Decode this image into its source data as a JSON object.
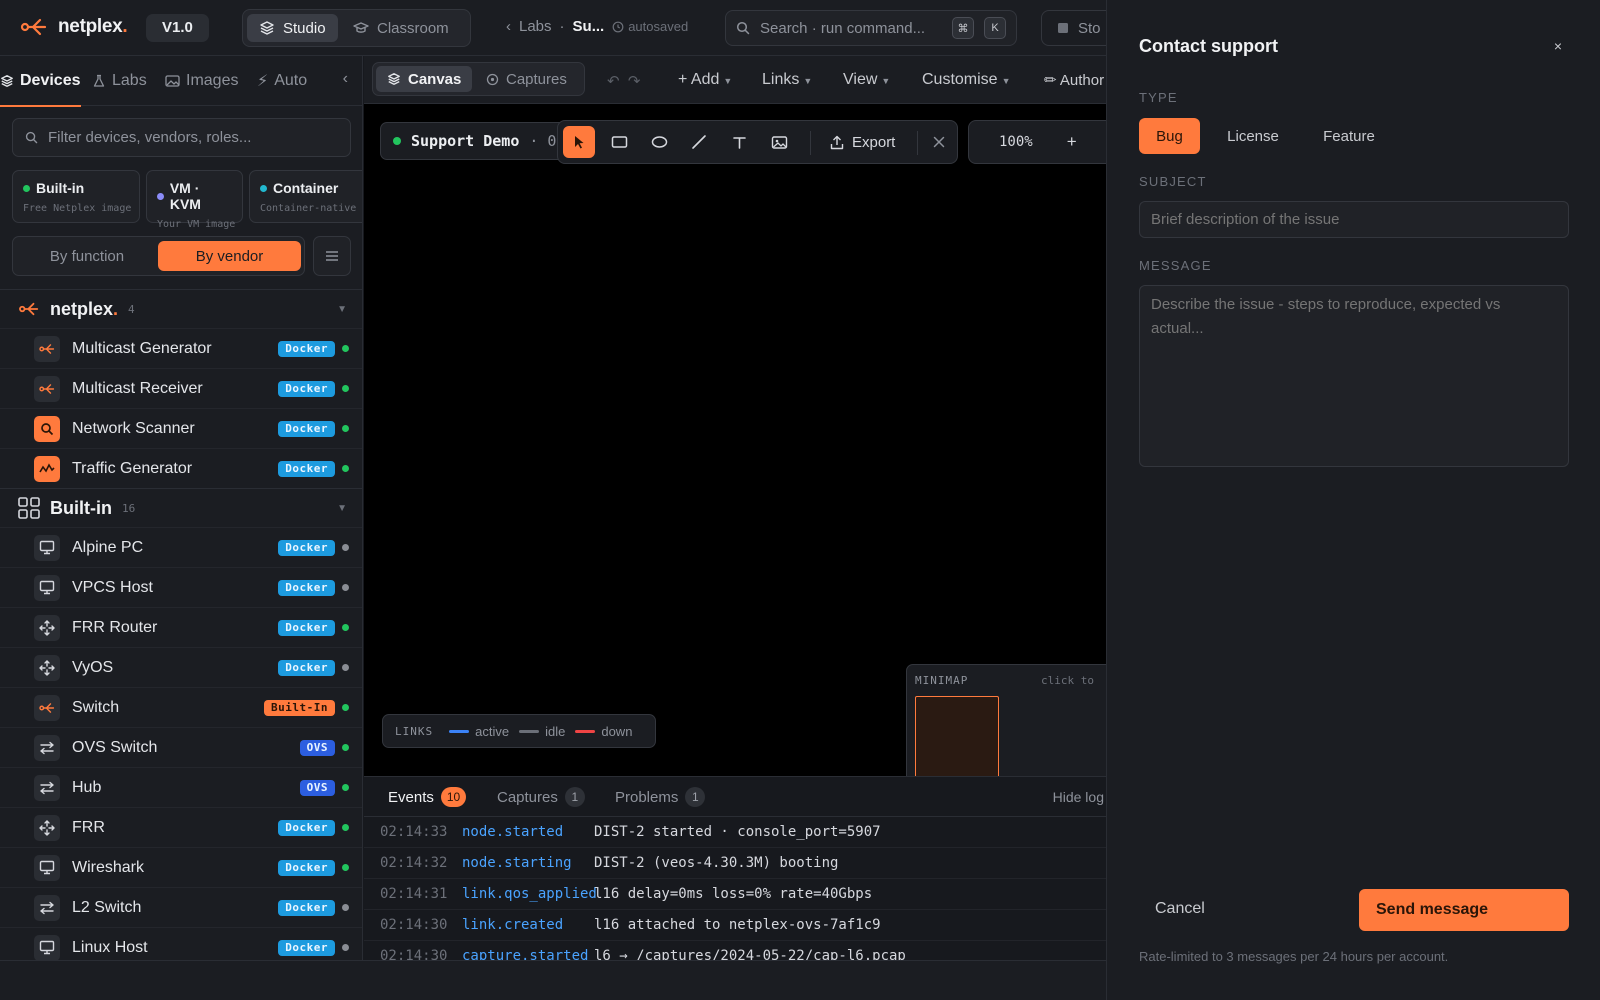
{
  "topbar": {
    "logo_text": "netplex",
    "logo_dot": ".",
    "version": "V1.0",
    "modes": [
      "Studio",
      "Classroom"
    ],
    "breadcrumb": {
      "back": "Labs",
      "sep": "·",
      "current": "Su...",
      "status": "autosaved"
    },
    "search_placeholder": "Search · run command...",
    "kbd": [
      "⌘",
      "K"
    ],
    "stop_label": "Sto"
  },
  "sidebar": {
    "tabs": [
      "Devices",
      "Labs",
      "Images",
      "Auto"
    ],
    "filter_placeholder": "Filter devices, vendors, roles...",
    "kinds": [
      {
        "label": "Built-in",
        "sub": "Free Netplex image",
        "color": "#22c55e"
      },
      {
        "label": "VM · KVM",
        "sub": "Your VM image",
        "color": "#8b8cf8"
      },
      {
        "label": "Container",
        "sub": "Container-native",
        "color": "#22b8cf"
      }
    ],
    "group_by": [
      "By function",
      "By vendor"
    ],
    "groups": [
      {
        "name": "netplex",
        "dot": ".",
        "count": "4",
        "items": [
          {
            "name": "Multicast Generator",
            "badge": "Docker",
            "badge_type": "docker",
            "status": "#22c55e",
            "icon": "netplex"
          },
          {
            "name": "Multicast Receiver",
            "badge": "Docker",
            "badge_type": "docker",
            "status": "#22c55e",
            "icon": "netplex"
          },
          {
            "name": "Network Scanner",
            "badge": "Docker",
            "badge_type": "docker",
            "status": "#22c55e",
            "icon": "scanner"
          },
          {
            "name": "Traffic Generator",
            "badge": "Docker",
            "badge_type": "docker",
            "status": "#22c55e",
            "icon": "traffic"
          }
        ]
      },
      {
        "name": "Built-in",
        "dot": "",
        "count": "16",
        "items": [
          {
            "name": "Alpine PC",
            "badge": "Docker",
            "badge_type": "docker",
            "status": "#8a8d94",
            "icon": "monitor"
          },
          {
            "name": "VPCS Host",
            "badge": "Docker",
            "badge_type": "docker",
            "status": "#8a8d94",
            "icon": "monitor"
          },
          {
            "name": "FRR Router",
            "badge": "Docker",
            "badge_type": "docker",
            "status": "#22c55e",
            "icon": "router"
          },
          {
            "name": "VyOS",
            "badge": "Docker",
            "badge_type": "docker",
            "status": "#8a8d94",
            "icon": "router"
          },
          {
            "name": "Switch",
            "badge": "Built-In",
            "badge_type": "builtin",
            "status": "#22c55e",
            "icon": "netplex"
          },
          {
            "name": "OVS Switch",
            "badge": "OVS",
            "badge_type": "ovs",
            "status": "#22c55e",
            "icon": "switch"
          },
          {
            "name": "Hub",
            "badge": "OVS",
            "badge_type": "ovs",
            "status": "#22c55e",
            "icon": "switch"
          },
          {
            "name": "FRR",
            "badge": "Docker",
            "badge_type": "docker",
            "status": "#22c55e",
            "icon": "router"
          },
          {
            "name": "Wireshark",
            "badge": "Docker",
            "badge_type": "docker",
            "status": "#22c55e",
            "icon": "monitor"
          },
          {
            "name": "L2 Switch",
            "badge": "Docker",
            "badge_type": "docker",
            "status": "#8a8d94",
            "icon": "switch"
          },
          {
            "name": "Linux Host",
            "badge": "Docker",
            "badge_type": "docker",
            "status": "#8a8d94",
            "icon": "monitor"
          }
        ]
      }
    ]
  },
  "canvas": {
    "tabs": [
      "Canvas",
      "Captures"
    ],
    "menus": [
      "+ Add",
      "Links",
      "View",
      "Customise",
      "✏ Author"
    ],
    "lab_name": "Support Demo",
    "lab_suffix": "· 0,",
    "export_label": "Export",
    "zoom": "100%",
    "zoom_plus": "+",
    "legend": {
      "title": "LINKS",
      "items": [
        {
          "label": "active",
          "color": "#3b82f6"
        },
        {
          "label": "idle",
          "color": "#6b6f78"
        },
        {
          "label": "down",
          "color": "#ef4444"
        }
      ]
    },
    "minimap": {
      "title": "MINIMAP",
      "hint": "click to"
    }
  },
  "log": {
    "tabs": [
      {
        "label": "Events",
        "count": "10"
      },
      {
        "label": "Captures",
        "count": "1"
      },
      {
        "label": "Problems",
        "count": "1"
      }
    ],
    "hide_label": "Hide log",
    "rows": [
      {
        "time": "02:14:33",
        "type": "node.started",
        "msg": "DIST-2 started · console_port=5907"
      },
      {
        "time": "02:14:32",
        "type": "node.starting",
        "msg": "DIST-2 (veos-4.30.3M) booting"
      },
      {
        "time": "02:14:31",
        "type": "link.qos_applied",
        "msg": "l16 delay=0ms loss=0% rate=40Gbps"
      },
      {
        "time": "02:14:30",
        "type": "link.created",
        "msg": "l16 attached to netplex-ovs-7af1c9"
      },
      {
        "time": "02:14:30",
        "type": "capture.started",
        "msg": "l6 → /captures/2024-05-22/cap-l6.pcap"
      }
    ]
  },
  "support": {
    "title": "Contact support",
    "close": "×",
    "type_label": "TYPE",
    "types": [
      "Bug",
      "License",
      "Feature"
    ],
    "subject_label": "SUBJECT",
    "subject_placeholder": "Brief description of the issue",
    "message_label": "MESSAGE",
    "message_placeholder": "Describe the issue - steps to reproduce, expected vs actual...",
    "cancel": "Cancel",
    "send": "Send message",
    "note": "Rate-limited to 3 messages per 24 hours per account."
  },
  "colors": {
    "accent": "#ff7a3d",
    "docker": "#1d9bdf",
    "ovs": "#2c5ee0"
  }
}
